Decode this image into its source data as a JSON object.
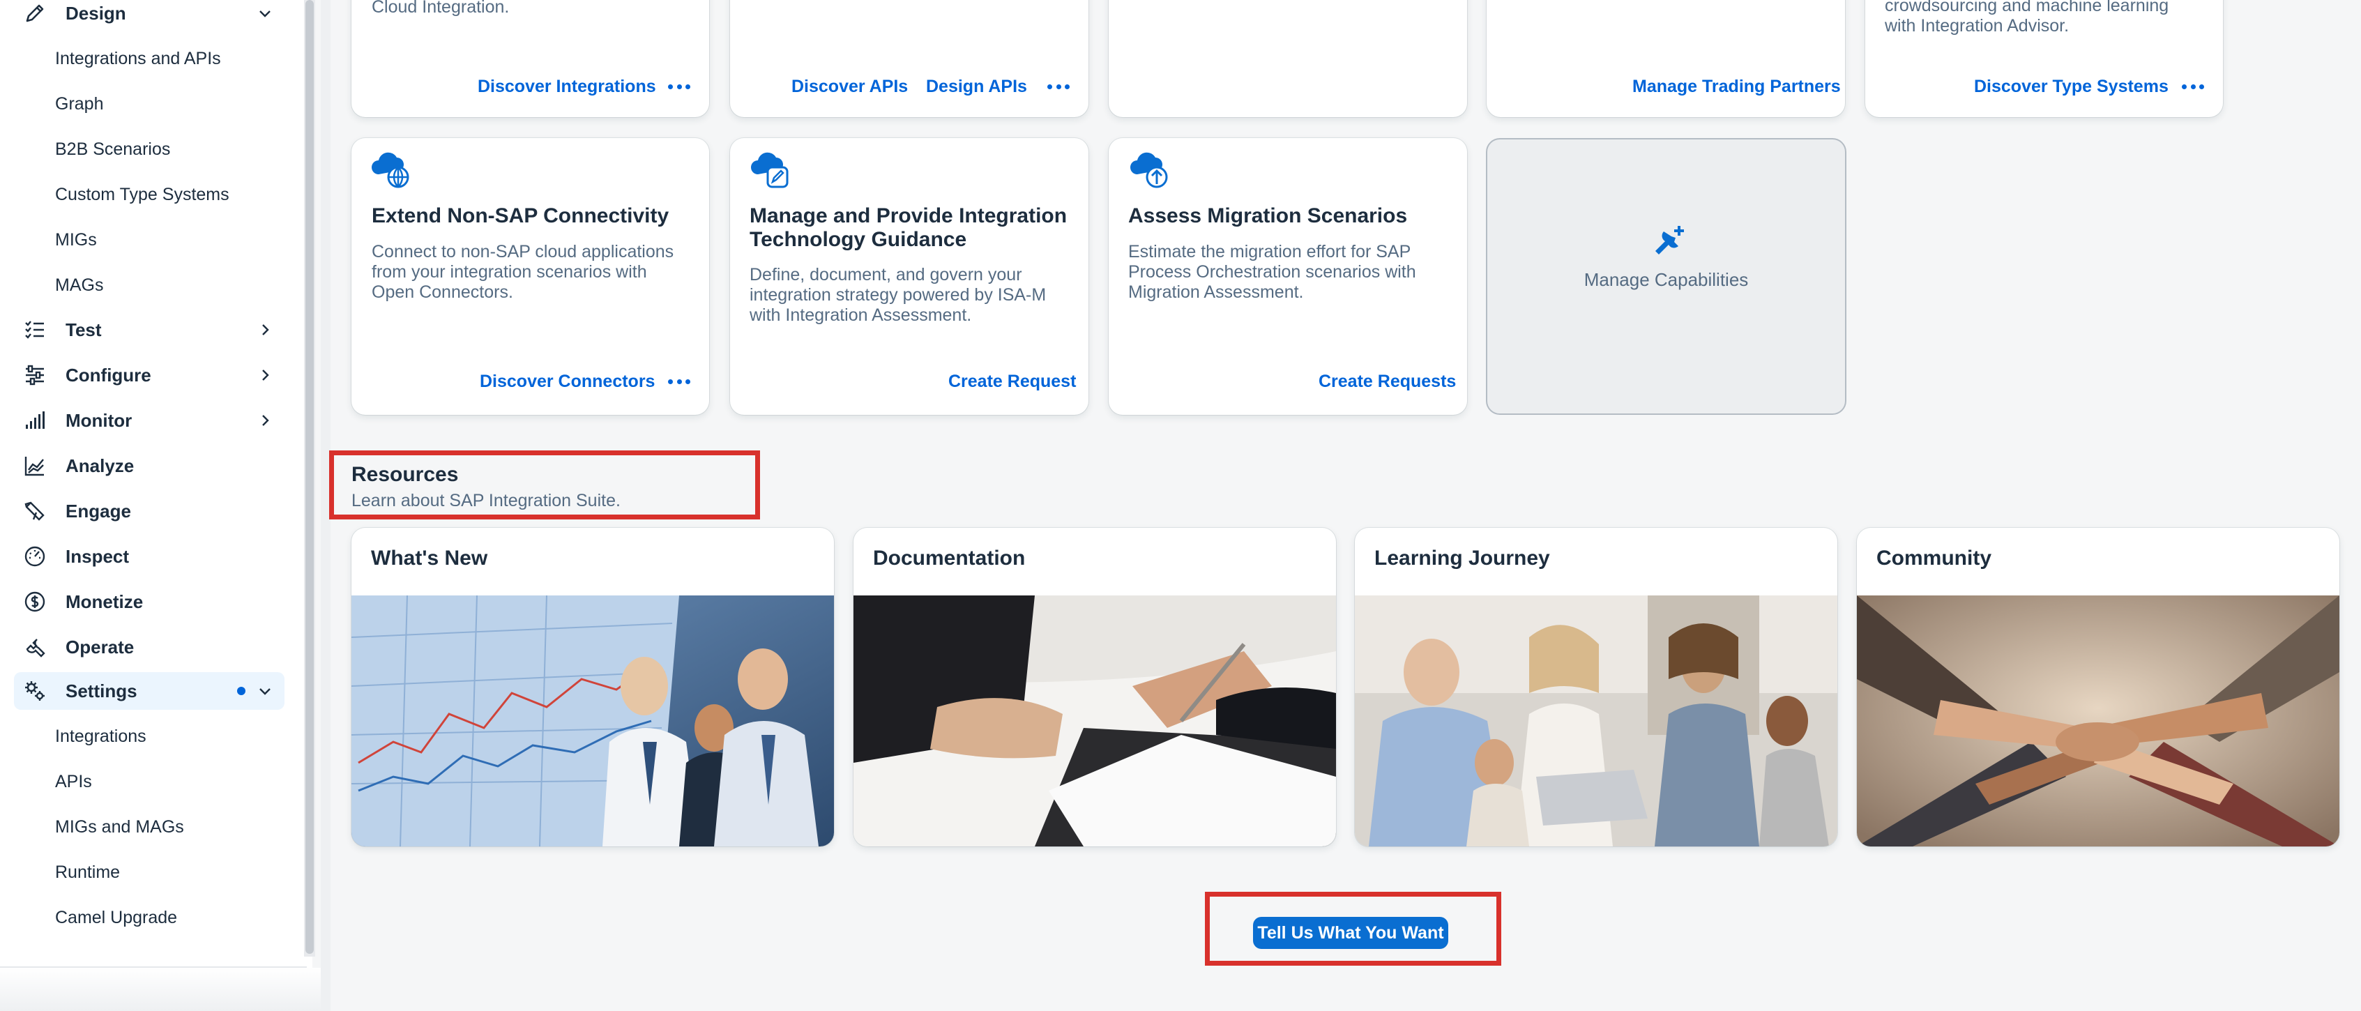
{
  "sidebar": {
    "design": {
      "label": "Design",
      "children": [
        "Integrations and APIs",
        "Graph",
        "B2B Scenarios",
        "Custom Type Systems",
        "MIGs",
        "MAGs"
      ]
    },
    "items": [
      {
        "label": "Test",
        "icon": "checklist-icon"
      },
      {
        "label": "Configure",
        "icon": "sliders-icon"
      },
      {
        "label": "Monitor",
        "icon": "bar-chart-icon"
      },
      {
        "label": "Analyze",
        "icon": "line-chart-icon"
      },
      {
        "label": "Engage",
        "icon": "engage-icon"
      },
      {
        "label": "Inspect",
        "icon": "gauge-icon"
      },
      {
        "label": "Monetize",
        "icon": "dollar-icon"
      },
      {
        "label": "Operate",
        "icon": "wrench-icon"
      }
    ],
    "settings": {
      "label": "Settings",
      "children": [
        "Integrations",
        "APIs",
        "MIGs and MAGs",
        "Runtime",
        "Camel Upgrade"
      ]
    }
  },
  "top_cards": [
    {
      "text_fragment": "Cloud Integration.",
      "links": [
        "Discover Integrations"
      ],
      "has_more": true
    },
    {
      "links": [
        "Discover APIs",
        "Design APIs"
      ],
      "has_more": true
    },
    {
      "links": [],
      "has_more": false
    },
    {
      "links": [
        "Manage Trading Partners"
      ],
      "has_more": false
    },
    {
      "text_fragment_1": "crowdsourcing and machine learning",
      "text_fragment_2": "with Integration Advisor.",
      "links": [
        "Discover Type Systems"
      ],
      "has_more": true
    }
  ],
  "cards": [
    {
      "title": "Extend Non-SAP Connectivity",
      "desc": [
        "Connect to non-SAP cloud applications",
        "from your integration scenarios with",
        "Open Connectors."
      ],
      "link": "Discover Connectors",
      "icon": "cloud-globe-icon"
    },
    {
      "title": [
        "Manage and Provide Integration",
        "Technology Guidance"
      ],
      "desc": [
        "Define, document, and govern your",
        "integration strategy powered by ISA-M",
        "with Integration Assessment."
      ],
      "link": "Create Request",
      "icon": "cloud-edit-icon"
    },
    {
      "title": "Assess Migration Scenarios",
      "desc": [
        "Estimate the migration effort for SAP",
        "Process Orchestration scenarios with",
        "Migration Assessment."
      ],
      "link": "Create Requests",
      "icon": "cloud-upload-icon"
    }
  ],
  "capabilities": {
    "label": "Manage Capabilities",
    "icon": "add-tool-icon"
  },
  "resources": {
    "title": "Resources",
    "subtitle": "Learn about SAP Integration Suite.",
    "tiles": [
      {
        "title": "What's New",
        "image": "business-people-at-data-wall"
      },
      {
        "title": "Documentation",
        "image": "hands-signing-documents"
      },
      {
        "title": "Learning Journey",
        "image": "team-studying-at-laptop"
      },
      {
        "title": "Community",
        "image": "stacked-hands-teamwork"
      }
    ]
  },
  "cta": {
    "label": "Tell Us What You Want"
  },
  "colors": {
    "brand": "#0064d9",
    "highlight": "#d8312c",
    "button": "#0a6ed1"
  }
}
